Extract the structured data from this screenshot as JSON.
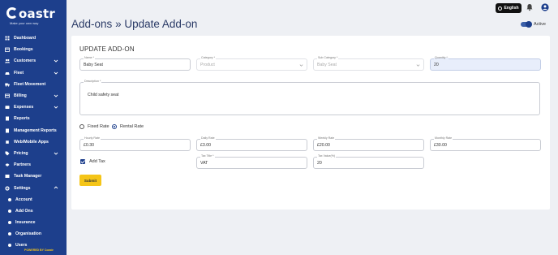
{
  "brand": {
    "name": "oastr",
    "tagline": "Make your own way"
  },
  "sidebar": {
    "items": [
      {
        "label": "Dashboard",
        "icon": "dashboard-icon",
        "chevron": false
      },
      {
        "label": "Bookings",
        "icon": "calendar-icon",
        "chevron": false
      },
      {
        "label": "Customers",
        "icon": "users-icon",
        "chevron": true
      },
      {
        "label": "Fleet",
        "icon": "car-icon",
        "chevron": true
      },
      {
        "label": "Fleet Movement",
        "icon": "truck-icon",
        "chevron": false
      },
      {
        "label": "Billing",
        "icon": "billing-icon",
        "chevron": true
      },
      {
        "label": "Expenses",
        "icon": "wallet-icon",
        "chevron": true
      },
      {
        "label": "Reports",
        "icon": "report-icon",
        "chevron": false
      },
      {
        "label": "Management Reports",
        "icon": "report-icon",
        "chevron": false
      },
      {
        "label": "Web/Mobile Apps",
        "icon": "mobile-icon",
        "chevron": false
      },
      {
        "label": "Pricing",
        "icon": "tag-icon",
        "chevron": true
      },
      {
        "label": "Partners",
        "icon": "handshake-icon",
        "chevron": false
      },
      {
        "label": "Task Manager",
        "icon": "task-icon",
        "chevron": false
      },
      {
        "label": "Settings",
        "icon": "gear-icon",
        "chevron": true,
        "expanded": true
      }
    ],
    "settings_sub": [
      "Account",
      "Add Ons",
      "Insurance",
      "Organisation",
      "Users"
    ],
    "powered_by": "POWERED BY Coastr"
  },
  "topbar": {
    "language": "English"
  },
  "page": {
    "breadcrumb_parent": "Add-ons",
    "separator": "»",
    "title": "Update Add-on",
    "active_label": "Active"
  },
  "form": {
    "heading": "UPDATE ADD-ON",
    "name": {
      "label": "Name *",
      "value": "Baby Seat"
    },
    "category": {
      "label": "Category *",
      "value": "Product"
    },
    "sub_category": {
      "label": "Sub Category *",
      "value": "Baby Seat"
    },
    "quantity": {
      "label": "Quantity *",
      "value": "20"
    },
    "description": {
      "label": "Description *",
      "value": "Child safety seat"
    },
    "rate_options": {
      "fixed": "Fixed Rate",
      "rental": "Rental Rate",
      "selected": "rental"
    },
    "hourly_rate": {
      "label": "Hourly Rate",
      "value": "£0.30"
    },
    "daily_rate": {
      "label": "Daily Rate",
      "value": "£3.00"
    },
    "weekly_rate": {
      "label": "Weekly Rate",
      "value": "£20.00"
    },
    "monthly_rate": {
      "label": "Monthly Rate",
      "value": "£30.00"
    },
    "add_tax": {
      "label": "Add Tax",
      "checked": true
    },
    "tax_title": {
      "label": "Tax Title *",
      "value": "VAT"
    },
    "tax_value": {
      "label": "Tax Value(%)",
      "value": "20"
    },
    "submit_label": "Submit"
  },
  "colors": {
    "sidebar": "#1d3f8c",
    "submit": "#f5c518",
    "accent": "#1d3f8c"
  }
}
